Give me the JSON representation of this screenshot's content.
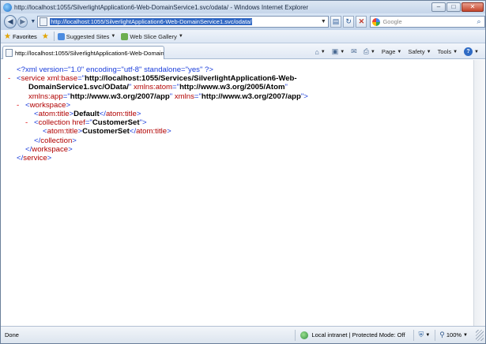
{
  "window": {
    "title": "http://localhost:1055/SilverlightApplication6-Web-DomainService1.svc/odata/ - Windows Internet Explorer",
    "minimize": "–",
    "maximize": "□",
    "close": "✕"
  },
  "address": {
    "url": "http://localhost:1055/SilverlightApplication6-Web-DomainService1.svc/odata/",
    "search_placeholder": "Google"
  },
  "favorites": {
    "label": "Favorites",
    "items": [
      {
        "label": "Suggested Sites",
        "has_menu": true
      },
      {
        "label": "Web Slice Gallery",
        "has_menu": true
      }
    ]
  },
  "tab": {
    "title": "http://localhost:1055/SilverlightApplication6-Web-DomainServi..."
  },
  "commands": {
    "page": "Page",
    "safety": "Safety",
    "tools": "Tools",
    "help": "?"
  },
  "xml": {
    "declaration": "<?xml version=\"1.0\" encoding=\"utf-8\" standalone=\"yes\" ?>",
    "service_base_value_1": "http://localhost:1055/Services/SilverlightApplication6-Web-",
    "service_base_value_2": "DomainService1.svc/OData/",
    "atom_ns_value": "http://www.w3.org/2005/Atom",
    "app_ns_value": "http://www.w3.org/2007/app",
    "xmlns_value": "http://www.w3.org/2007/app",
    "workspace_title": "Default",
    "collection_href": "CustomerSet",
    "collection_title": "CustomerSet"
  },
  "status": {
    "text": "Done",
    "zone": "Local intranet | Protected Mode: Off",
    "zoom": "100%"
  },
  "colors": {
    "markup_blue": "#1a3ddb",
    "attribute_red": "#b00000",
    "collapse_red": "#dd0000",
    "url_highlight": "#3168c4"
  }
}
